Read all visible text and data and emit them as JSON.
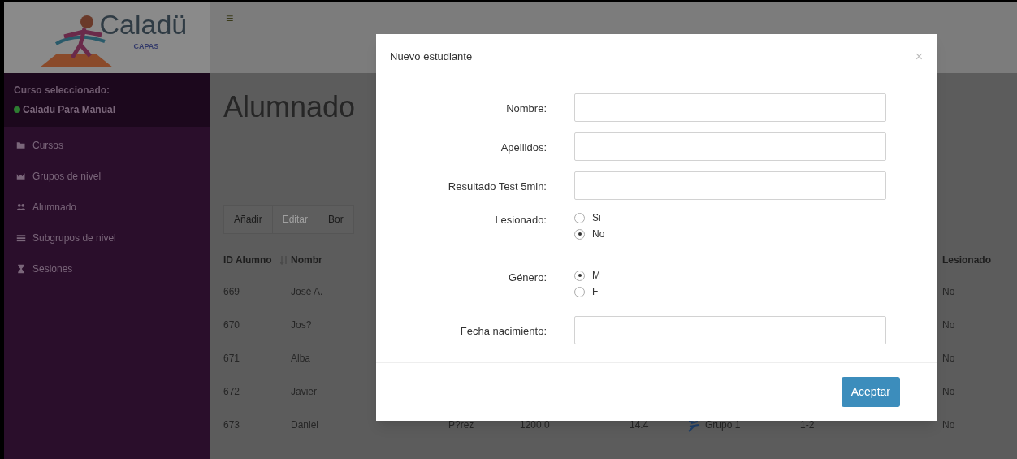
{
  "logo": {
    "name": "Caladü",
    "subtitle": "CAPAS"
  },
  "header": {
    "menu_glyph": "≡"
  },
  "sidebar": {
    "course_label": "Curso seleccionado:",
    "course_name": "Caladu Para Manual",
    "items": [
      {
        "label": "Cursos"
      },
      {
        "label": "Grupos de nivel"
      },
      {
        "label": "Alumnado"
      },
      {
        "label": "Subgrupos de nivel"
      },
      {
        "label": "Sesiones"
      }
    ]
  },
  "page": {
    "title": "Alumnado",
    "toolbar": [
      {
        "label": "Añadir",
        "disabled": false
      },
      {
        "label": "Editar",
        "disabled": true
      },
      {
        "label": "Bor",
        "disabled": false
      }
    ],
    "table": {
      "columns": [
        "ID Alumno",
        "Nombr",
        null,
        null,
        null,
        null,
        null,
        "Lesionado"
      ],
      "rows": [
        {
          "cells": [
            "669",
            "José A.",
            null,
            null,
            null,
            null,
            null,
            "No"
          ]
        },
        {
          "cells": [
            "670",
            "Jos?",
            null,
            null,
            null,
            null,
            null,
            "No"
          ]
        },
        {
          "cells": [
            "671",
            "Alba",
            null,
            null,
            null,
            null,
            null,
            "No"
          ]
        },
        {
          "cells": [
            "672",
            "Javier",
            null,
            null,
            null,
            null,
            null,
            "No"
          ]
        },
        {
          "cells": [
            "673",
            "Daniel",
            "P?rez",
            "1200.0",
            "14.4",
            "Grupo 1",
            "1-2",
            "No"
          ]
        }
      ]
    }
  },
  "modal": {
    "title": "Nuevo estudiante",
    "close": "×",
    "fields": [
      {
        "kind": "text",
        "label": "Nombre:"
      },
      {
        "kind": "text",
        "label": "Apellidos:"
      },
      {
        "kind": "text",
        "label": "Resultado Test 5min:"
      },
      {
        "kind": "radio",
        "label": "Lesionado:",
        "options": [
          {
            "label": "Si",
            "selected": false
          },
          {
            "label": "No",
            "selected": true
          }
        ]
      },
      {
        "kind": "radio",
        "label": "Género:",
        "options": [
          {
            "label": "M",
            "selected": true
          },
          {
            "label": "F",
            "selected": false
          }
        ]
      },
      {
        "kind": "text",
        "label": "Fecha nacimiento:"
      }
    ],
    "button": "Aceptar"
  }
}
